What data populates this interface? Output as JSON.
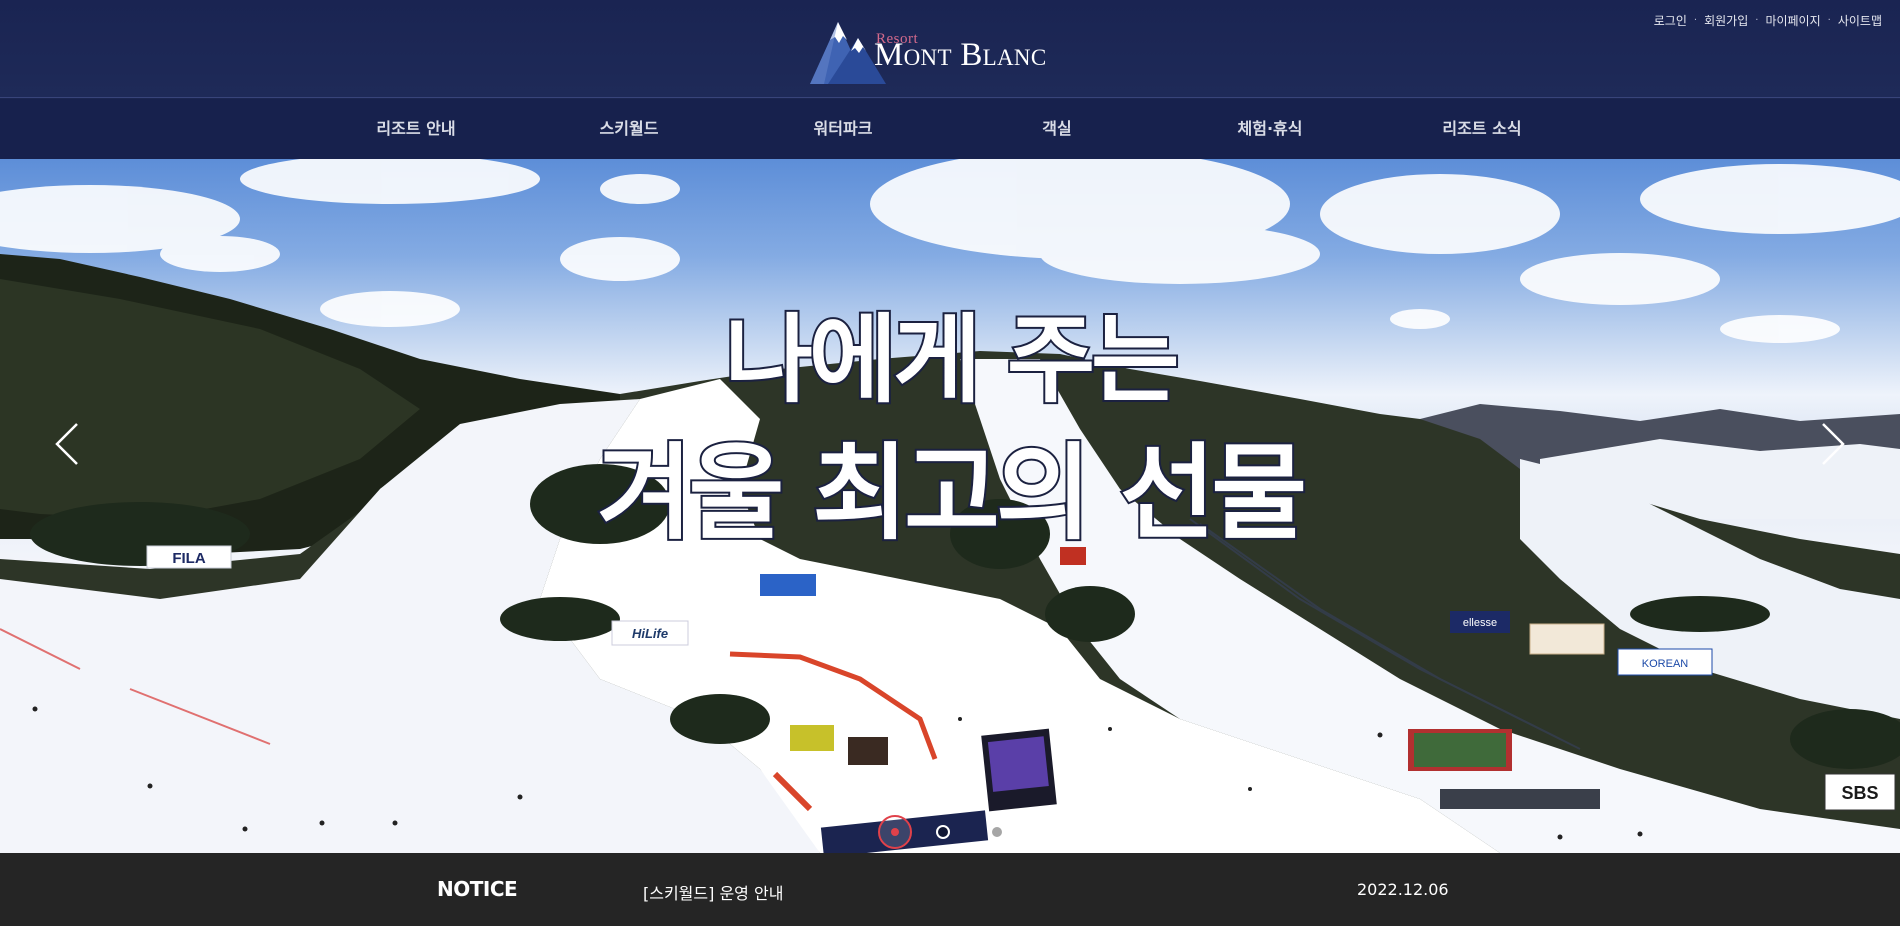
{
  "utility_nav": {
    "items": [
      "로그인",
      "회원가입",
      "마이페이지",
      "사이트맵"
    ],
    "separator": "·"
  },
  "logo": {
    "small_text": "Resort",
    "main_text": "Mont Blanc",
    "icon": "mountain-logo-icon"
  },
  "nav": {
    "items": [
      "리조트 안내",
      "스키월드",
      "워터파크",
      "객실",
      "체험·휴식",
      "리조트 소식"
    ]
  },
  "hero": {
    "headline_line1": "나에게 주는",
    "headline_line2": "겨울 최고의 선물",
    "prev_icon": "chevron-left-icon",
    "next_icon": "chevron-right-icon",
    "slide_count": 3,
    "active_slide": 1,
    "signs": {
      "fila": "FILA",
      "hilife": "HiLife",
      "ellesse": "ellesse",
      "korean": "KOREAN",
      "sbs": "SBS"
    }
  },
  "notice": {
    "label": "NOTICE",
    "title": "[스키월드] 운영 안내",
    "date": "2022.12.06"
  },
  "colors": {
    "header_bg": "#1b2650",
    "notice_bg": "#252525",
    "accent_red": "#e0414a"
  }
}
